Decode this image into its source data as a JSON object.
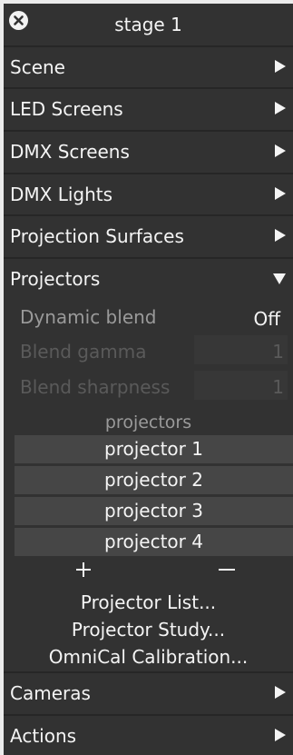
{
  "panel": {
    "title": "stage 1"
  },
  "sections": [
    {
      "label": "Scene",
      "state": "collapsed"
    },
    {
      "label": "LED Screens",
      "state": "collapsed"
    },
    {
      "label": "DMX Screens",
      "state": "collapsed"
    },
    {
      "label": "DMX Lights",
      "state": "collapsed"
    },
    {
      "label": "Projection Surfaces",
      "state": "collapsed"
    },
    {
      "label": "Projectors",
      "state": "expanded"
    },
    {
      "label": "Cameras",
      "state": "collapsed"
    },
    {
      "label": "Actions",
      "state": "collapsed"
    }
  ],
  "projectors": {
    "dynamic_blend": {
      "label": "Dynamic blend",
      "value": "Off"
    },
    "blend_gamma": {
      "label": "Blend gamma",
      "value": "1",
      "enabled": false
    },
    "blend_sharpness": {
      "label": "Blend sharpness",
      "value": "1",
      "enabled": false
    },
    "list_header": "projectors",
    "items": [
      "projector 1",
      "projector 2",
      "projector 3",
      "projector 4"
    ],
    "add_label": "+",
    "remove_label": "−",
    "links": [
      "Projector List...",
      "Projector Study...",
      "OmniCal Calibration..."
    ]
  },
  "icons": {
    "close": "close-icon",
    "collapsed": "triangle-right-icon",
    "expanded": "triangle-down-icon"
  },
  "colors": {
    "panel_bg": "#323232",
    "row_divider": "#262626",
    "text": "#f4f4f4",
    "muted_text": "#9a9a9a",
    "disabled_text": "#5a5a5a",
    "list_row_bg": "#464646",
    "frame_bg": "#ececec"
  }
}
